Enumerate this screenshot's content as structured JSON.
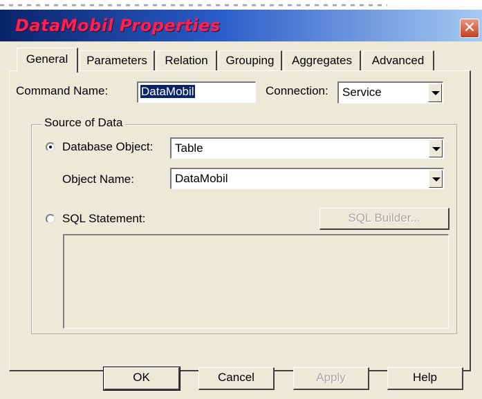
{
  "window": {
    "title": "DataMobil Properties",
    "close_label": "✕"
  },
  "tabs": [
    {
      "label": "General",
      "active": true
    },
    {
      "label": "Parameters",
      "active": false
    },
    {
      "label": "Relation",
      "active": false
    },
    {
      "label": "Grouping",
      "active": false
    },
    {
      "label": "Aggregates",
      "active": false
    },
    {
      "label": "Advanced",
      "active": false
    }
  ],
  "general": {
    "command_name_label": "Command Name:",
    "command_name_value": "DataMobil",
    "connection_label": "Connection:",
    "connection_value": "Service",
    "source_group_label": "Source of Data",
    "database_object_label": "Database Object:",
    "database_object_checked": true,
    "database_object_value": "Table",
    "object_name_label": "Object Name:",
    "object_name_value": "DataMobil",
    "sql_statement_label": "SQL Statement:",
    "sql_statement_checked": false,
    "sql_builder_label": "SQL Builder...",
    "sql_text": ""
  },
  "buttons": {
    "ok": "OK",
    "cancel": "Cancel",
    "apply": "Apply",
    "help": "Help"
  },
  "colors": {
    "title_text": "#ff1f52",
    "title_bar_start": "#0a246a",
    "title_bar_end": "#a6caf0",
    "dialog_bg": "#ece9d8",
    "selection": "#0a246a"
  }
}
